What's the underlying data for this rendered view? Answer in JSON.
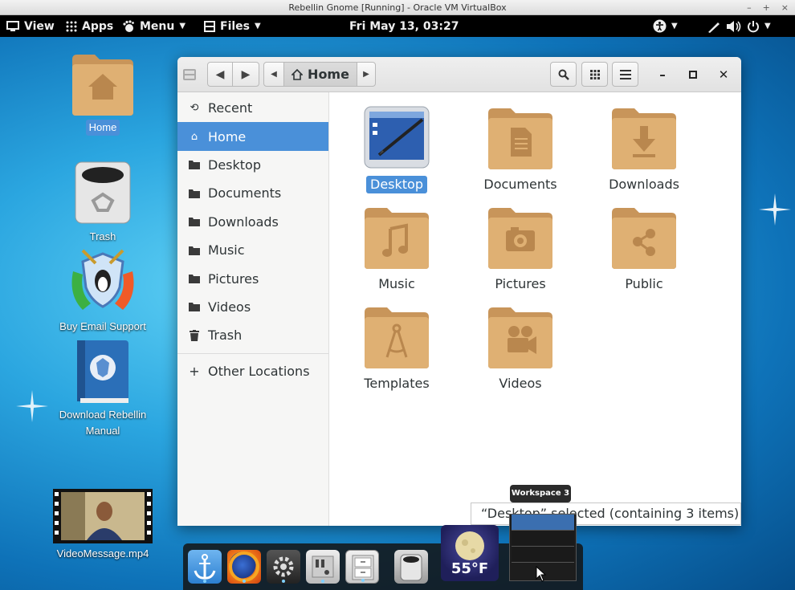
{
  "vbox": {
    "title": "Rebellin Gnome [Running] - Oracle VM VirtualBox",
    "ctrl_min": "–",
    "ctrl_max": "+",
    "ctrl_close": "×"
  },
  "topbar": {
    "view_label": "View",
    "apps_label": "Apps",
    "menu_label": "Menu",
    "files_label": "Files",
    "clock": "Fri May 13, 03:27"
  },
  "desktop_icons": {
    "home": "Home",
    "trash": "Trash",
    "email_support": "Buy Email Support",
    "manual_line1": "Download Rebellin",
    "manual_line2": "Manual",
    "video": "VideoMessage.mp4"
  },
  "files_window": {
    "path_label": "Home",
    "sidebar": [
      {
        "label": "Recent",
        "icon": "clock-icon"
      },
      {
        "label": "Home",
        "icon": "home-icon",
        "active": true
      },
      {
        "label": "Desktop",
        "icon": "folder-icon"
      },
      {
        "label": "Documents",
        "icon": "folder-icon"
      },
      {
        "label": "Downloads",
        "icon": "folder-icon"
      },
      {
        "label": "Music",
        "icon": "folder-icon"
      },
      {
        "label": "Pictures",
        "icon": "folder-icon"
      },
      {
        "label": "Videos",
        "icon": "folder-icon"
      },
      {
        "label": "Trash",
        "icon": "trash-icon"
      }
    ],
    "other_locations": "Other Locations",
    "folders": [
      "Desktop",
      "Documents",
      "Downloads",
      "Music",
      "Pictures",
      "Public",
      "Templates",
      "Videos"
    ],
    "status": "“Desktop” selected (containing 3 items)"
  },
  "dock": {
    "workspace_tooltip": "Workspace 3",
    "weather_temp": "55°F"
  },
  "colors": {
    "accent": "#4a90d9",
    "folder": "#d9a865",
    "topbar": "#000000"
  }
}
